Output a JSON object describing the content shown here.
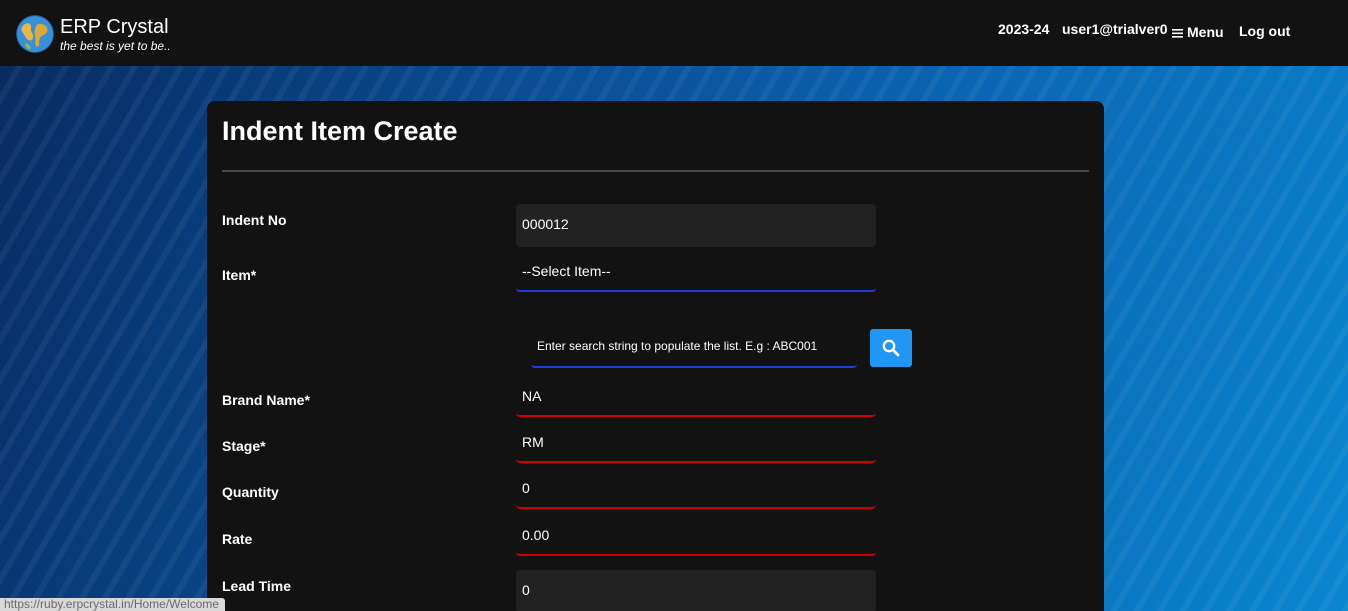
{
  "header": {
    "brand_title": "ERP Crystal",
    "brand_tagline": "the best is yet to be..",
    "logo_icon": "globe-icon",
    "financial_year": "2023-24",
    "username": "user1@trialver0",
    "menu_label": "Menu",
    "menu_icon": "hamburger-icon",
    "logout_label": "Log out"
  },
  "form": {
    "title": "Indent Item Create",
    "fields": [
      {
        "label": "Indent No",
        "value": "000012"
      },
      {
        "label": "Item*",
        "value": "--Select Item--"
      },
      {
        "label": "Brand Name*",
        "value": "NA"
      },
      {
        "label": "Stage*",
        "value": "RM"
      },
      {
        "label": "Quantity",
        "value": "0"
      },
      {
        "label": "Rate",
        "value": "0.00"
      },
      {
        "label": "Lead Time",
        "value": "0"
      }
    ],
    "search": {
      "placeholder": "Enter search string to populate the list. E.g : ABC001",
      "button_icon": "search-icon"
    }
  },
  "status_bar": {
    "url": "https://ruby.erpcrystal.in/Home/Welcome"
  },
  "colors": {
    "navbar_bg": "#121212",
    "card_bg": "#121212",
    "required_underline": "#d00000",
    "focus_underline": "#1f3fd8",
    "button_accent": "#2196f3"
  }
}
